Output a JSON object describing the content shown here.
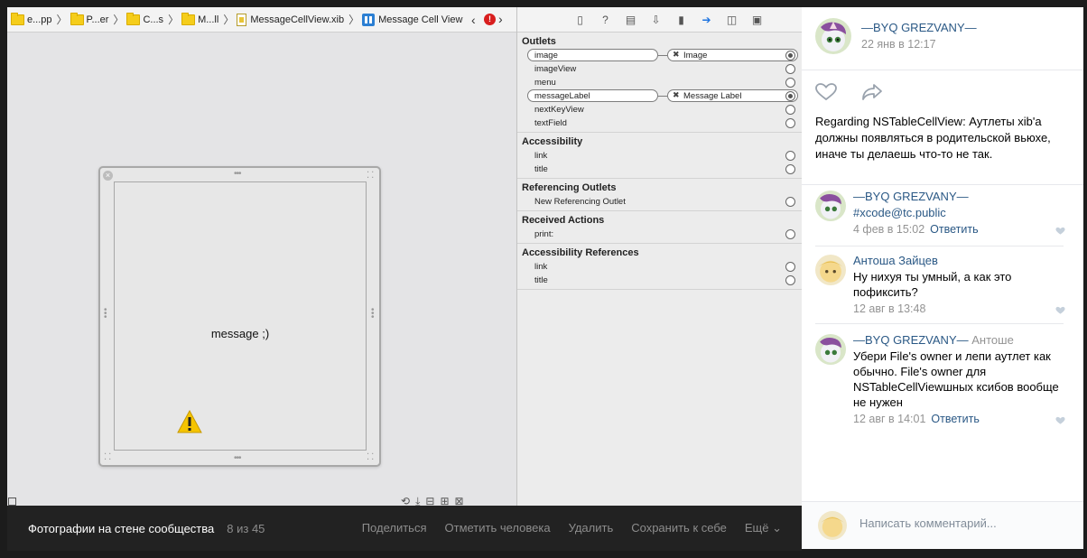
{
  "xcode": {
    "breadcrumbs": [
      "e...pp",
      "P...er",
      "C...s",
      "M...ll",
      "MessageCellView.xib",
      "Message Cell View"
    ],
    "error_count": "!",
    "cell_label": "message ;)",
    "inspector": {
      "sections": [
        {
          "title": "Outlets",
          "rows": [
            {
              "name": "image",
              "target": "Image",
              "connected": true
            },
            {
              "name": "imageView",
              "target": "",
              "connected": false
            },
            {
              "name": "menu",
              "target": "",
              "connected": false
            },
            {
              "name": "messageLabel",
              "target": "Message Label",
              "connected": true
            },
            {
              "name": "nextKeyView",
              "target": "",
              "connected": false
            },
            {
              "name": "textField",
              "target": "",
              "connected": false
            }
          ]
        },
        {
          "title": "Accessibility",
          "rows": [
            {
              "name": "link"
            },
            {
              "name": "title"
            }
          ]
        },
        {
          "title": "Referencing Outlets",
          "rows": [
            {
              "name": "New Referencing Outlet"
            }
          ]
        },
        {
          "title": "Received Actions",
          "rows": [
            {
              "name": "print:"
            }
          ]
        },
        {
          "title": "Accessibility References",
          "rows": [
            {
              "name": "link"
            },
            {
              "name": "title"
            }
          ]
        }
      ]
    }
  },
  "photobar": {
    "title": "Фотографии на стене сообщества",
    "count": "8 из 45",
    "actions": [
      "Поделиться",
      "Отметить человека",
      "Удалить",
      "Сохранить к себе",
      "Ещё"
    ]
  },
  "post": {
    "author": "—BYQ GREZVANY—",
    "date": "22 янв в 12:17",
    "text": "Regarding NSTableCellView: Аутлеты xib'a должны появляться в родительской вьюхе, иначе ты делаешь что-то не так."
  },
  "comments": [
    {
      "author": "—BYQ GREZVANY—",
      "to": "",
      "text": "#xcode@tc.public",
      "date": "4 фев в 15:02",
      "reply": "Ответить"
    },
    {
      "author": "Антоша Зайцев",
      "to": "",
      "text": "Ну нихуя ты умный, а как это пофиксить?",
      "date": "12 авг в 13:48",
      "reply": ""
    },
    {
      "author": "—BYQ GREZVANY—",
      "to": "Антоше",
      "text": "Убери File's owner и лепи аутлет как обычно. File's owner для NSTableCellViewшных ксибов вообще не нужен",
      "date": "12 авг в 14:01",
      "reply": "Ответить"
    }
  ],
  "comment_input": {
    "placeholder": "Написать комментарий..."
  },
  "colors": {
    "link": "#2a5885",
    "meta": "#939393",
    "selected_tab": "#1e74e0",
    "error": "#d81e1e"
  }
}
